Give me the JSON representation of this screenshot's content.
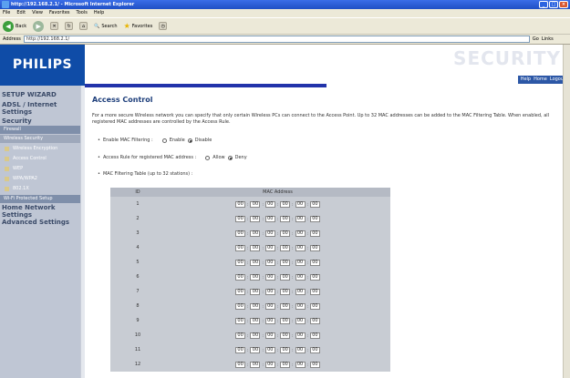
{
  "window": {
    "title": "http://192.168.2.1/ - Microsoft Internet Explorer"
  },
  "menu": [
    "File",
    "Edit",
    "View",
    "Favorites",
    "Tools",
    "Help"
  ],
  "toolbar": {
    "back": "Back",
    "search": "Search",
    "favorites": "Favorites"
  },
  "address": {
    "label": "Address",
    "url": "http://192.168.2.1/",
    "go": "Go",
    "links": "Links"
  },
  "brand": {
    "logo": "PHILIPS",
    "banner": "SECURITY"
  },
  "header_links": {
    "help": "Help",
    "home": "Home",
    "logout": "Logout"
  },
  "sidebar": {
    "setup_wizard": "SETUP WIZARD",
    "adsl": "ADSL / Internet Settings",
    "security": "Security",
    "firewall": "Firewall",
    "wireless_security": "Wireless Security",
    "wireless_encryption": "Wireless Encryption",
    "access_control": "Access Control",
    "wep": "WEP",
    "wpa": "WPA/WPA2",
    "dot1x": "802.1X",
    "wps": "Wi-Fi Protected Setup",
    "home_network": "Home Network Settings",
    "advanced": "Advanced Settings"
  },
  "content": {
    "title": "Access Control",
    "description": "For a more secure Wireless network you can specify that only certain Wireless PCs can connect to the Access Point. Up to 32 MAC addresses can be added to the MAC Filtering Table. When enabled, all registered MAC addresses are controlled by the Access Rule.",
    "enable_label": "Enable MAC Filtering :",
    "enable_opt": "Enable",
    "disable_opt": "Disable",
    "enable_selected": "Disable",
    "rule_label": "Access Rule for registered MAC address :",
    "allow_opt": "Allow",
    "deny_opt": "Deny",
    "rule_selected": "Deny",
    "table_label": "MAC Filtering Table (up to 32 stations) :"
  },
  "table": {
    "headers": [
      "ID",
      "MAC Address"
    ],
    "rows": [
      {
        "id": "1",
        "mac": [
          "00",
          "00",
          "00",
          "00",
          "00",
          "00"
        ]
      },
      {
        "id": "2",
        "mac": [
          "00",
          "00",
          "00",
          "00",
          "00",
          "00"
        ]
      },
      {
        "id": "3",
        "mac": [
          "00",
          "00",
          "00",
          "00",
          "00",
          "00"
        ]
      },
      {
        "id": "4",
        "mac": [
          "00",
          "00",
          "00",
          "00",
          "00",
          "00"
        ]
      },
      {
        "id": "5",
        "mac": [
          "00",
          "00",
          "00",
          "00",
          "00",
          "00"
        ]
      },
      {
        "id": "6",
        "mac": [
          "00",
          "00",
          "00",
          "00",
          "00",
          "00"
        ]
      },
      {
        "id": "7",
        "mac": [
          "00",
          "00",
          "00",
          "00",
          "00",
          "00"
        ]
      },
      {
        "id": "8",
        "mac": [
          "00",
          "00",
          "00",
          "00",
          "00",
          "00"
        ]
      },
      {
        "id": "9",
        "mac": [
          "00",
          "00",
          "00",
          "00",
          "00",
          "00"
        ]
      },
      {
        "id": "10",
        "mac": [
          "00",
          "00",
          "00",
          "00",
          "00",
          "00"
        ]
      },
      {
        "id": "11",
        "mac": [
          "00",
          "00",
          "00",
          "00",
          "00",
          "00"
        ]
      },
      {
        "id": "12",
        "mac": [
          "00",
          "00",
          "00",
          "00",
          "00",
          "00"
        ]
      }
    ]
  }
}
